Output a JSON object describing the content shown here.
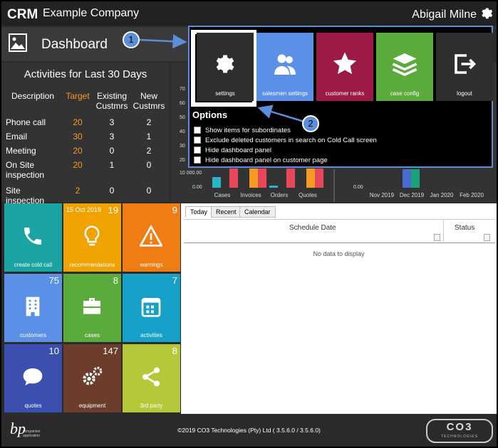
{
  "header": {
    "company": "Example Company",
    "user": "Abigail Milne"
  },
  "dashboard": {
    "title": "Dashboard"
  },
  "activities": {
    "title": "Activities for Last 30 Days",
    "columns": [
      "Description",
      "Target",
      "Existing Custmrs",
      "New Custmrs"
    ],
    "col_desc": "Description",
    "col_target": "Target",
    "col_existing_1": "Existing",
    "col_existing_2": "Custmrs",
    "col_new_1": "New",
    "col_new_2": "Custmrs",
    "rows": [
      {
        "desc": "Phone call",
        "target": "20",
        "existing": "3",
        "new": "2"
      },
      {
        "desc": "Email",
        "target": "30",
        "existing": "3",
        "new": "1"
      },
      {
        "desc": "Meeting",
        "target": "20",
        "existing": "0",
        "new": "2"
      },
      {
        "desc": "On Site",
        "desc2": "inspection",
        "target": "20",
        "existing": "1",
        "new": "0"
      },
      {
        "desc": "Site inspection",
        "target": "2",
        "existing": "0",
        "new": "0"
      }
    ]
  },
  "chart_data": [
    {
      "type": "bar",
      "categories": [
        "Cases",
        "Invoices",
        "Orders",
        "Quotes"
      ],
      "y_ticks_visible": [
        "70",
        "60",
        "50",
        "40",
        "30",
        "20",
        "10 000.00",
        "0.00"
      ],
      "colors": [
        "#2bb3c8",
        "#f59a23",
        "#e8465a"
      ],
      "values_visible_heights_fraction": [
        [
          0.55,
          0.0,
          0.95
        ],
        [
          0.0,
          0.95,
          0.95
        ],
        [
          0.12,
          0.0,
          0.95
        ],
        [
          0.0,
          0.95,
          0.95
        ]
      ]
    },
    {
      "type": "bar",
      "categories": [
        "Nov 2019",
        "Dec 2019",
        "Jan 2020",
        "Feb 2020"
      ],
      "y_ticks_visible": [
        "0.00"
      ],
      "colors": [
        "#4a6bd0",
        "#1aa27a"
      ]
    }
  ],
  "popup": {
    "tiles": [
      {
        "label": "settings",
        "icon": "gear-icon",
        "color": "#2e2e2e"
      },
      {
        "label": "salesmen settings",
        "icon": "users-icon",
        "color": "#5b8fe8"
      },
      {
        "label": "customer ranks",
        "icon": "star-icon",
        "color": "#9b1b45"
      },
      {
        "label": "case config",
        "icon": "layers-icon",
        "color": "#5aaa3c"
      },
      {
        "label": "logout",
        "icon": "logout-icon",
        "color": "#2e2e2e"
      }
    ],
    "options_title": "Options",
    "options": [
      "Show items for subordinates",
      "Exclude deleted customers in search on Cold Call screen",
      "Hide dashboard panel",
      "Hide dashboard panel on customer page"
    ]
  },
  "callouts": [
    "1",
    "2"
  ],
  "tiles": [
    {
      "label": "create cold call",
      "count": "",
      "date": "",
      "color": "#1aa4a4",
      "icon": "phone-icon"
    },
    {
      "label": "recommendations",
      "count": "19",
      "date": "15 Oct 2019",
      "color": "#f0a300",
      "icon": "lightbulb-icon"
    },
    {
      "label": "warnings",
      "count": "9",
      "date": "",
      "color": "#f07d14",
      "icon": "warning-icon"
    },
    {
      "label": "customers",
      "count": "75",
      "date": "",
      "color": "#5b8fe8",
      "icon": "building-icon"
    },
    {
      "label": "cases",
      "count": "8",
      "date": "",
      "color": "#5aaa3c",
      "icon": "briefcase-icon"
    },
    {
      "label": "activities",
      "count": "7",
      "date": "",
      "color": "#16a2c8",
      "icon": "calendar-icon"
    },
    {
      "label": "quotes",
      "count": "10",
      "date": "",
      "color": "#3a4fb0",
      "icon": "chat-icon"
    },
    {
      "label": "equipment",
      "count": "147",
      "date": "",
      "color": "#6b3d2a",
      "icon": "gears-icon"
    },
    {
      "label": "3rd party",
      "count": "8",
      "date": "",
      "color": "#b6c83a",
      "icon": "share-icon"
    }
  ],
  "schedule": {
    "tabs": [
      "Today",
      "Recent",
      "Calendar"
    ],
    "col_date": "Schedule Date",
    "col_status": "Status",
    "empty": "No data to display"
  },
  "footer": {
    "copyright": "©2019 CO3 Technologies (Pty) Ltd ( 3.5.6.0 / 3.5.6.0)",
    "bp_text_1": "companion",
    "bp_text_2": "application",
    "brand": "CO3",
    "brand_sub": "TECHNOLOGIES"
  }
}
